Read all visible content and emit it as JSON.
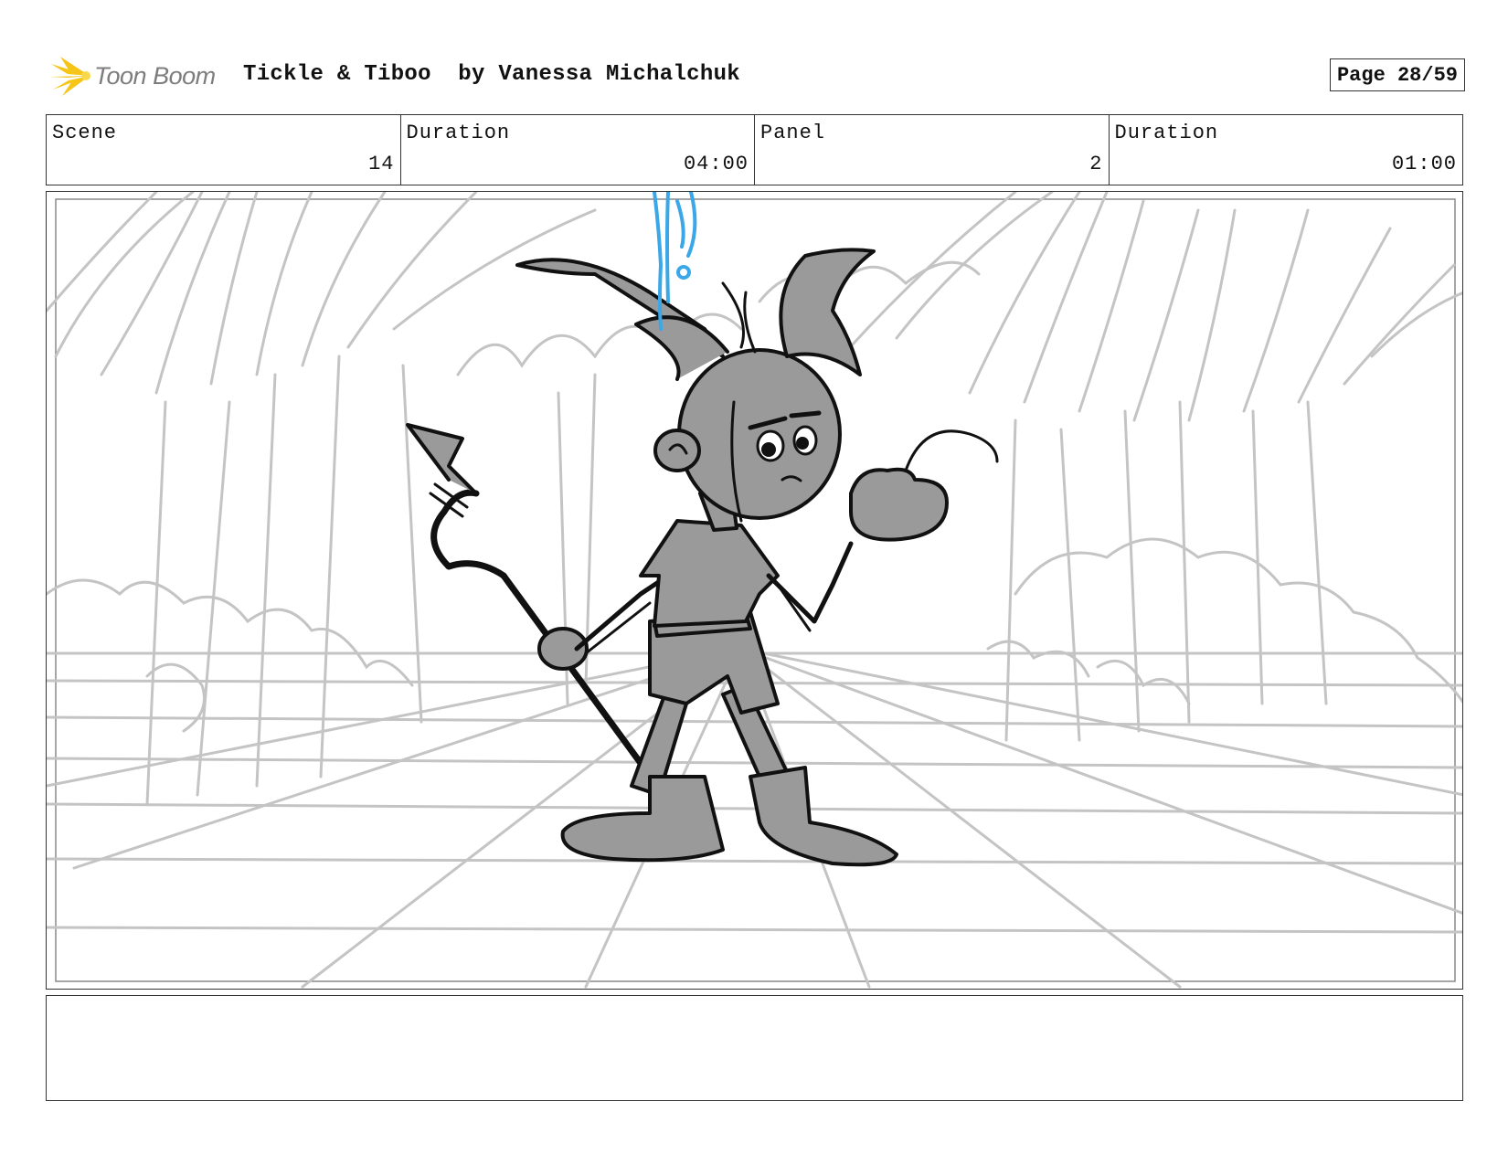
{
  "header": {
    "logo_text": "Toon Boom",
    "project_title": "Tickle & Tiboo  by Vanessa Michalchuk",
    "page_label": "Page 28/59"
  },
  "info": {
    "scene_label": "Scene",
    "scene_value": "14",
    "scene_duration_label": "Duration",
    "scene_duration_value": "04:00",
    "panel_label": "Panel",
    "panel_value": "2",
    "panel_duration_label": "Duration",
    "panel_duration_value": "01:00"
  },
  "notes": {
    "text": ""
  },
  "colors": {
    "logo_yellow": "#f5c518",
    "sketch_grey": "#c4c4c4",
    "character_fill": "#9a9a9a",
    "ink": "#111111",
    "blue_accent": "#3aa7e8"
  }
}
